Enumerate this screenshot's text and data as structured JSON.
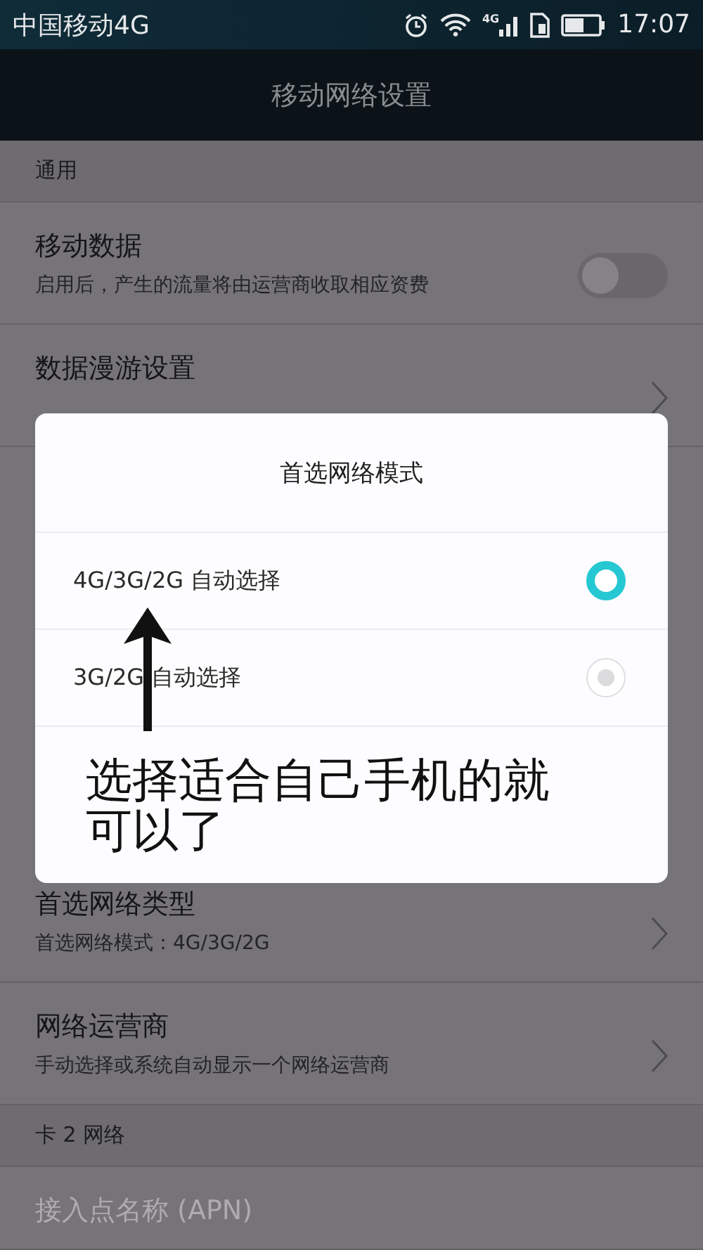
{
  "status_bar": {
    "carrier": "中国移动4G",
    "network": "4G",
    "time": "17:07"
  },
  "title": "移动网络设置",
  "settings_above": [
    {
      "kind": "header",
      "title": "通用"
    },
    {
      "kind": "toggle",
      "title": "移动数据",
      "subtitle": "启用后，产生的流量将由运营商收取相应资费",
      "on": false,
      "disabled": false
    },
    {
      "kind": "link",
      "title": "数据漫游设置",
      "disabled": false
    }
  ],
  "settings_below": [
    {
      "kind": "link",
      "title": "首选网络类型",
      "subtitle": "首选网络模式：4G/3G/2G",
      "disabled": false
    },
    {
      "kind": "link",
      "title": "网络运营商",
      "subtitle": "手动选择或系统自动显示一个网络运营商",
      "disabled": false
    },
    {
      "kind": "header",
      "title": "卡 2 网络"
    },
    {
      "kind": "plain",
      "title": "接入点名称 (APN)",
      "disabled": true
    }
  ],
  "dialog": {
    "title": "首选网络模式",
    "options": [
      {
        "label": "4G/3G/2G 自动选择",
        "selected": true
      },
      {
        "label": "3G/2G 自动选择",
        "selected": false
      }
    ],
    "annotation": "选择适合自己手机的就可以了"
  }
}
